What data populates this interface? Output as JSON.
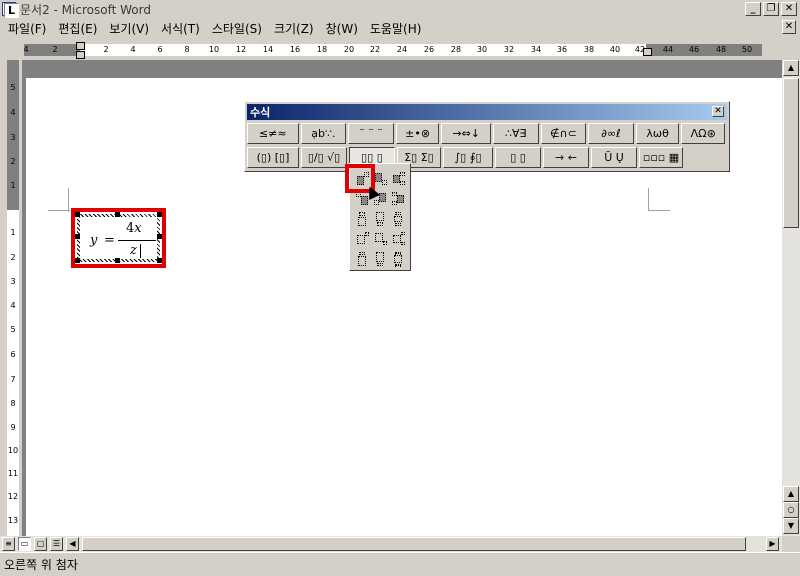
{
  "window": {
    "title": "문서2 - Microsoft Word",
    "app_icon": "W",
    "controls": [
      "_",
      "❐",
      "✕"
    ]
  },
  "menu": {
    "items": [
      "파일(F)",
      "편집(E)",
      "보기(V)",
      "서식(T)",
      "스타일(S)",
      "크기(Z)",
      "창(W)",
      "도움말(H)"
    ],
    "doc_close": "✕"
  },
  "ruler": {
    "tab_selector": "L",
    "h_labels": [
      "4",
      "2",
      "2",
      "4",
      "6",
      "8",
      "10",
      "12",
      "14",
      "16",
      "18",
      "20",
      "22",
      "24",
      "26",
      "28",
      "30",
      "32",
      "34",
      "36",
      "38",
      "40",
      "42",
      "44",
      "46",
      "48",
      "50"
    ],
    "v_labels": [
      "5",
      "4",
      "3",
      "2",
      "1",
      "1",
      "2",
      "3",
      "4",
      "5",
      "6",
      "7",
      "8",
      "9",
      "10",
      "11",
      "12",
      "13"
    ]
  },
  "equation": {
    "lhs": "y",
    "equals": "=",
    "numerator_coef": "4",
    "numerator_var": "x",
    "denominator": "z"
  },
  "palette": {
    "title": "수식",
    "close": "✕",
    "row1": [
      "≤≠≈",
      "ạb∵.",
      "¨ ¨ ¨",
      "±•⊗",
      "→⇔↓",
      "∴∀∃",
      "∉∩⊂",
      "∂∞ℓ",
      "λωθ",
      "ΛΩ⊛"
    ],
    "row2": [
      "(▯) [▯]",
      "▯/▯ √▯",
      "▯▯ ▯",
      "Σ▯ Σ▯",
      "∫▯ ∮▯",
      "▯ ▯",
      "→ ←",
      "Ũ Ų",
      "▫▫▫ ▦"
    ]
  },
  "status": {
    "text": "오른쪽 위 첨자"
  },
  "icons": {
    "app": "word-doc-icon",
    "cursor": "mouse-pointer-icon"
  }
}
